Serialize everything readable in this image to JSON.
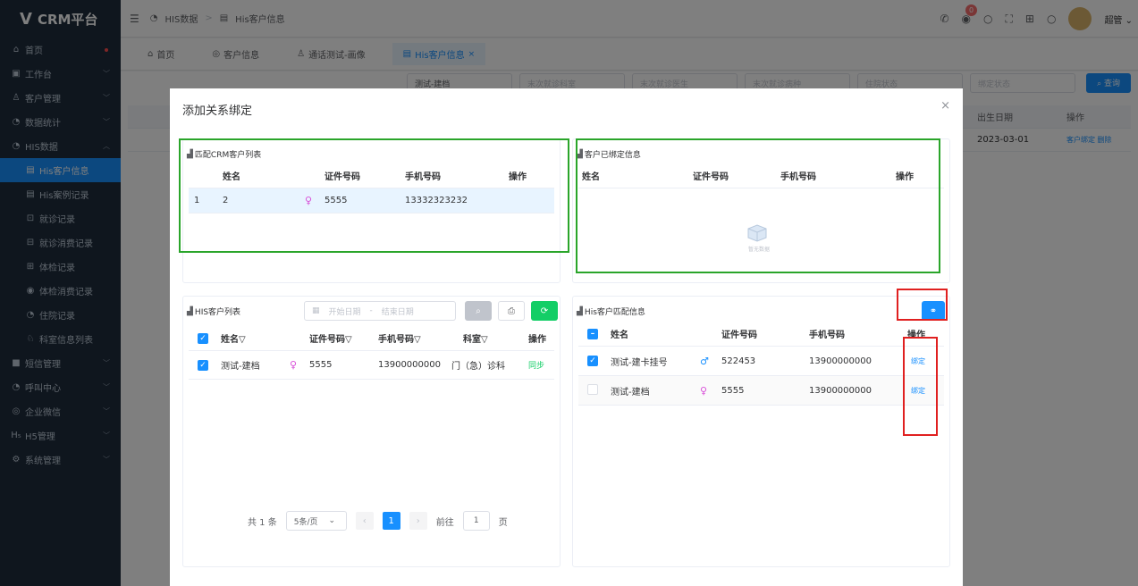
{
  "app": {
    "title": "CRM平台",
    "logo_letter": "V"
  },
  "sidebar": {
    "items": [
      {
        "label": "首页",
        "icon": "home-icon",
        "glyph": "⌂"
      },
      {
        "label": "工作台",
        "icon": "briefcase-icon",
        "glyph": "▣"
      },
      {
        "label": "客户管理",
        "icon": "user-icon",
        "glyph": "♙"
      },
      {
        "label": "数据统计",
        "icon": "chart-icon",
        "glyph": "◔"
      },
      {
        "label": "HIS数据",
        "icon": "database-icon",
        "glyph": "◔"
      },
      {
        "label": "His客户信息",
        "icon": "file-icon",
        "glyph": "▤"
      },
      {
        "label": "His案例记录",
        "icon": "record-icon",
        "glyph": "▤"
      },
      {
        "label": "就诊记录",
        "icon": "scan-icon",
        "glyph": "⊡"
      },
      {
        "label": "就诊消费记录",
        "icon": "bill-icon",
        "glyph": "⊟"
      },
      {
        "label": "体检记录",
        "icon": "clipboard-icon",
        "glyph": "⊞"
      },
      {
        "label": "体检消费记录",
        "icon": "circle-icon",
        "glyph": "◉"
      },
      {
        "label": "住院记录",
        "icon": "hospital-icon",
        "glyph": "◔"
      },
      {
        "label": "科室信息列表",
        "icon": "team-icon",
        "glyph": "♘"
      },
      {
        "label": "短信管理",
        "icon": "message-icon",
        "glyph": "■"
      },
      {
        "label": "呼叫中心",
        "icon": "phone-icon",
        "glyph": "◔"
      },
      {
        "label": "企业微信",
        "icon": "wechat-icon",
        "glyph": "◎"
      },
      {
        "label": "H5管理",
        "icon": "h5-icon",
        "glyph": "H₅"
      },
      {
        "label": "系统管理",
        "icon": "settings-icon",
        "glyph": "⚙"
      }
    ]
  },
  "header": {
    "breadcrumb": [
      "HIS数据",
      "His客户信息"
    ],
    "notification_count": "0",
    "username": "超管"
  },
  "tabs": [
    {
      "label": "首页"
    },
    {
      "label": "客户信息"
    },
    {
      "label": "通话测试-画像"
    },
    {
      "label": "His客户信息"
    }
  ],
  "background": {
    "filters": [
      "测试-建档",
      "末次就诊科室",
      "末次就诊医生",
      "末次就诊病种",
      "住院状态",
      "绑定状态"
    ],
    "query_label": "查询",
    "col_birth": "出生日期",
    "col_ops": "操作",
    "row_birth": "2023-03-01",
    "row_ops": "客户绑定  删除"
  },
  "dialog": {
    "title": "添加关系绑定",
    "crm_panel": {
      "title": "匹配CRM客户列表",
      "columns": [
        "姓名",
        "证件号码",
        "手机号码",
        "操作"
      ],
      "rows": [
        {
          "index": "1",
          "name": "2",
          "id_no": "5555",
          "phone": "13332323232"
        }
      ]
    },
    "bound_panel": {
      "title": "客户已绑定信息",
      "columns": [
        "姓名",
        "证件号码",
        "手机号码",
        "操作"
      ],
      "empty_text": "暂无数据"
    },
    "his_list_panel": {
      "title": "HIS客户列表",
      "start_placeholder": "开始日期",
      "end_placeholder": "结束日期",
      "date_sep": "-",
      "columns": [
        "姓名",
        "证件号码",
        "手机号码",
        "科室",
        "操作"
      ],
      "rows": [
        {
          "name": "测试-建档",
          "id_no": "5555",
          "phone": "13900000000",
          "dept": "门（急）诊科",
          "op": "同步"
        }
      ],
      "pagination": {
        "total": "共 1 条",
        "page_size": "5条/页",
        "current": "1",
        "goto_label": "前往",
        "goto_value": "1",
        "page_suffix": "页"
      }
    },
    "his_match_panel": {
      "title": "His客户匹配信息",
      "columns": [
        "姓名",
        "证件号码",
        "手机号码",
        "操作"
      ],
      "rows": [
        {
          "name": "测试-建卡挂号",
          "gender": "male",
          "id_no": "522453",
          "phone": "13900000000",
          "op": "绑定",
          "checked": true
        },
        {
          "name": "测试-建档",
          "gender": "female",
          "id_no": "5555",
          "phone": "13900000000",
          "op": "绑定",
          "checked": false
        }
      ]
    }
  }
}
